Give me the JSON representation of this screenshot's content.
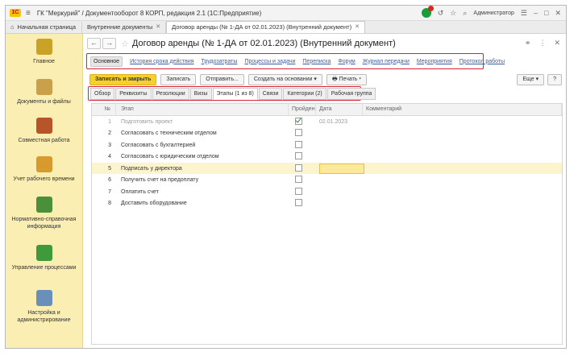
{
  "app": {
    "title": "ГК \"Меркурий\" / Документооборот 8 КОРП, редакция 2.1  (1С:Предприятие)",
    "user": "Администратор",
    "logo_text": "1С"
  },
  "tabs": [
    {
      "label": "Начальная страница"
    },
    {
      "label": "Внутренние документы"
    },
    {
      "label": "Договор аренды (№ 1-ДА от 02.01.2023) (Внутренний документ)"
    }
  ],
  "sidebar": {
    "items": [
      {
        "label": "Главное",
        "icon": "home-icon",
        "color": "#c9a227"
      },
      {
        "label": "Документы и файлы",
        "icon": "documents-icon",
        "color": "#caa04a"
      },
      {
        "label": "Совместная работа",
        "icon": "people-icon",
        "color": "#b8542a"
      },
      {
        "label": "Учет рабочего времени",
        "icon": "clock-icon",
        "color": "#d89a2e"
      },
      {
        "label": "Нормативно-справочная информация",
        "icon": "books-icon",
        "color": "#4c8f3a"
      },
      {
        "label": "Управление процессами",
        "icon": "process-icon",
        "color": "#3e9a3a"
      },
      {
        "label": "Настройка и администрирование",
        "icon": "computer-icon",
        "color": "#6a8fb8"
      }
    ]
  },
  "document": {
    "title": "Договор аренды (№ 1-ДА от 02.01.2023) (Внутренний документ)",
    "nav_back": "←",
    "nav_forward": "→"
  },
  "panel_links": [
    {
      "label": "Основное",
      "selected": true
    },
    {
      "label": "История срока действия"
    },
    {
      "label": "Трудозатраты"
    },
    {
      "label": "Процессы и задачи"
    },
    {
      "label": "Переписка"
    },
    {
      "label": "Форум"
    },
    {
      "label": "Журнал передачи"
    },
    {
      "label": "Мероприятия"
    },
    {
      "label": "Протокол работы"
    }
  ],
  "toolbar": {
    "save_close": "Записать и закрыть",
    "save": "Записать",
    "send": "Отправить...",
    "create_based": "Создать на основании",
    "print": "Печать",
    "more": "Еще",
    "help": "?"
  },
  "panel_tabs": [
    {
      "label": "Обзор"
    },
    {
      "label": "Реквизиты"
    },
    {
      "label": "Резолюции"
    },
    {
      "label": "Визы"
    },
    {
      "label": "Этапы (1 из 8)",
      "active": true
    },
    {
      "label": "Связи"
    },
    {
      "label": "Категории (2)"
    },
    {
      "label": "Рабочая группа"
    }
  ],
  "grid": {
    "columns": {
      "num": "№",
      "stage": "Этап",
      "done": "Пройден",
      "date": "Дата",
      "comment": "Комментарий"
    },
    "rows": [
      {
        "num": "1",
        "stage": "Подготовить проект",
        "done": true,
        "date": "02.01.2023",
        "comment": ""
      },
      {
        "num": "2",
        "stage": "Согласовать с техническим отделом",
        "done": false,
        "date": "",
        "comment": ""
      },
      {
        "num": "3",
        "stage": "Согласовать с бухгалтерией",
        "done": false,
        "date": "",
        "comment": ""
      },
      {
        "num": "4",
        "stage": "Согласовать с юридическим отделом",
        "done": false,
        "date": "",
        "comment": ""
      },
      {
        "num": "5",
        "stage": "Подписать у директора",
        "done": false,
        "date": "",
        "comment": "",
        "selected": true
      },
      {
        "num": "6",
        "stage": "Получить счет на предоплату",
        "done": false,
        "date": "",
        "comment": ""
      },
      {
        "num": "7",
        "stage": "Оплатить счет",
        "done": false,
        "date": "",
        "comment": ""
      },
      {
        "num": "8",
        "stage": "Доставить оборудование",
        "done": false,
        "date": "",
        "comment": ""
      }
    ]
  },
  "colors": {
    "accent": "#f7d02c",
    "sidebar": "#fbeeb3",
    "highlight": "#d9232e",
    "link": "#3a5fa0"
  }
}
